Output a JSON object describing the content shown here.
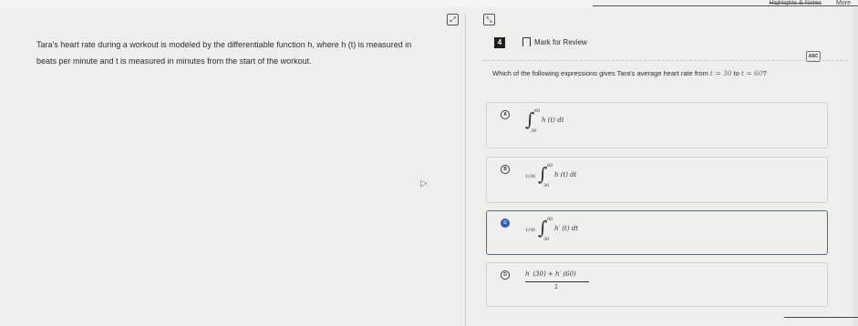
{
  "toolbar": {
    "more_label": "More",
    "strike_label": "Highlights & Notes",
    "icon_one": "expand-icon",
    "icon_two": "collapse-icon"
  },
  "passage": {
    "line1": "Tara's heart rate during a workout is modeled by the differentiable function h, where h (t) is measured in",
    "line2": "beats per minute and t is measured in minutes from the start of the workout."
  },
  "question_header": {
    "number": "4",
    "mark_label": "Mark for Review",
    "abc_label": "ABC"
  },
  "question": {
    "text_before": "Which of the following expressions gives Tara's average heart rate from ",
    "from_expr": "t = 30",
    "to_word": " to ",
    "to_expr": "t = 60",
    "text_after": "?"
  },
  "choices": [
    {
      "letter": "A",
      "coef": "",
      "upper": "60",
      "lower": "30",
      "body": "h (t) dt",
      "selected": false
    },
    {
      "letter": "B",
      "coef": "1/30",
      "upper": "60",
      "lower": "30",
      "body": "h (t) dt",
      "selected": false
    },
    {
      "letter": "C",
      "coef": "1/30",
      "upper": "60",
      "lower": "30",
      "body": "h′ (t) dt",
      "selected": true
    },
    {
      "letter": "D",
      "numerator": "h′ (30) + h′ (60)",
      "denominator": "2",
      "selected": false
    }
  ],
  "colors": {
    "selected_border": "#3d6bd1",
    "selected_badge": "#2a59c8"
  }
}
